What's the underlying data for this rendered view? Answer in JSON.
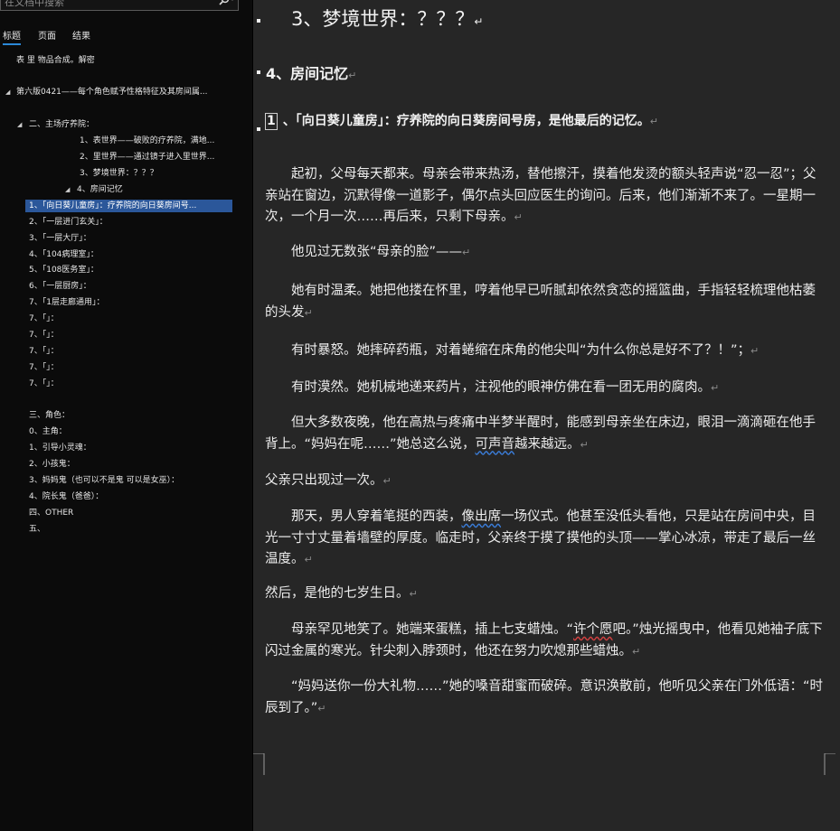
{
  "search": {
    "placeholder": "在文档中搜索",
    "dropdown_glyph": "▾"
  },
  "nav_tabs": [
    "标题",
    "页面",
    "结果"
  ],
  "nav_items": [
    {
      "text": "表 里 物品合成。解密"
    },
    {
      "text": "第六版0421——每个角色赋予性格特征及其房间属..."
    },
    {
      "text": "二、主场疗养院："
    },
    {
      "text": "1、表世界——破败的疗养院，满地..."
    },
    {
      "text": "2、里世界——通过镜子进入里世界..."
    },
    {
      "text": "3、梦境世界：？？？"
    },
    {
      "text": "4、房间记忆"
    },
    {
      "text": "1、「向日葵儿童房」：疗养院的向日葵房间号..."
    },
    {
      "text": "2、「一层进门玄关」："
    },
    {
      "text": "3、「一层大厅」："
    },
    {
      "text": "4、「104病理室」："
    },
    {
      "text": "5、「108医务室」："
    },
    {
      "text": "6、「一层厨房」："
    },
    {
      "text": "7、「1层走廊通用」："
    },
    {
      "text": "7、「」："
    },
    {
      "text": "7、「」："
    },
    {
      "text": "7、「」："
    },
    {
      "text": "7、「」："
    },
    {
      "text": "7、「」："
    },
    {
      "text": "三、角色："
    },
    {
      "text": "0、主角："
    },
    {
      "text": "1、引导小灵魂："
    },
    {
      "text": "2、小孩鬼："
    },
    {
      "text": "3、妈妈鬼（也可以不是鬼 可以是女巫）："
    },
    {
      "text": "4、院长鬼（爸爸）："
    },
    {
      "text": "四、OTHER"
    },
    {
      "text": "五、"
    }
  ],
  "doc": {
    "mark": "↵",
    "heading1": "3、梦境世界：？？？",
    "heading2": "4、房间记忆",
    "heading3_num": "1",
    "heading3_text": "、「向日葵儿童房」：疗养院的向日葵房间号房，是他最后的记忆。",
    "p1": "起初，父母每天都来。母亲会带来热汤，替他擦汗，摸着他发烫的额头轻声说“忍一忍”；父亲站在窗边，沉默得像一道影子，偶尔点头回应医生的询问。后来，他们渐渐不来了。一星期一次，一个月一次……再后来，只剩下母亲。",
    "p2": "他见过无数张“母亲的脸”——",
    "p3": "她有时温柔。她把他搂在怀里，哼着他早已听腻却依然贪恋的摇篮曲，手指轻轻梳理他枯萎的头发",
    "p4": "有时暴怒。她摔碎药瓶，对着蜷缩在床角的他尖叫“为什么你总是好不了？！”；",
    "p5": "有时漠然。她机械地递来药片，注视他的眼神仿佛在看一团无用的腐肉。",
    "p6a": "但大多数夜晚，他在高热与疼痛中半梦半醒时，能感到母亲坐在床边，眼泪一滴滴砸在他手背上。“妈妈在呢……”她总这么说，",
    "p6b": "可声音",
    "p6c": "越来越远。",
    "p7": "父亲只出现过一次。",
    "p8a": "那天，男人穿着笔挺的西装，",
    "p8b": "像出席",
    "p8c": "一场仪式。他甚至没低头看他，只是站在房间中央，目光一寸寸丈量着墙壁的厚度。临走时，父亲终于摸了摸他的头顶——掌心冰凉，带走了最后一丝温度。",
    "p9": "然后，是他的七岁生日。",
    "p10a": "母亲罕见地笑了。她端来蛋糕，插上七支蜡烛。“",
    "p10b": "许个愿",
    "p10c": "吧。”烛光摇曳中，他看见她袖子底下闪过金属的寒光。针尖刺入脖颈时，他还在努力吹熄那些蜡烛。",
    "p11": "“妈妈送你一份大礼物……”她的嗓音甜蜜而破碎。意识涣散前，他听见父亲在门外低语：“时辰到了。”"
  }
}
